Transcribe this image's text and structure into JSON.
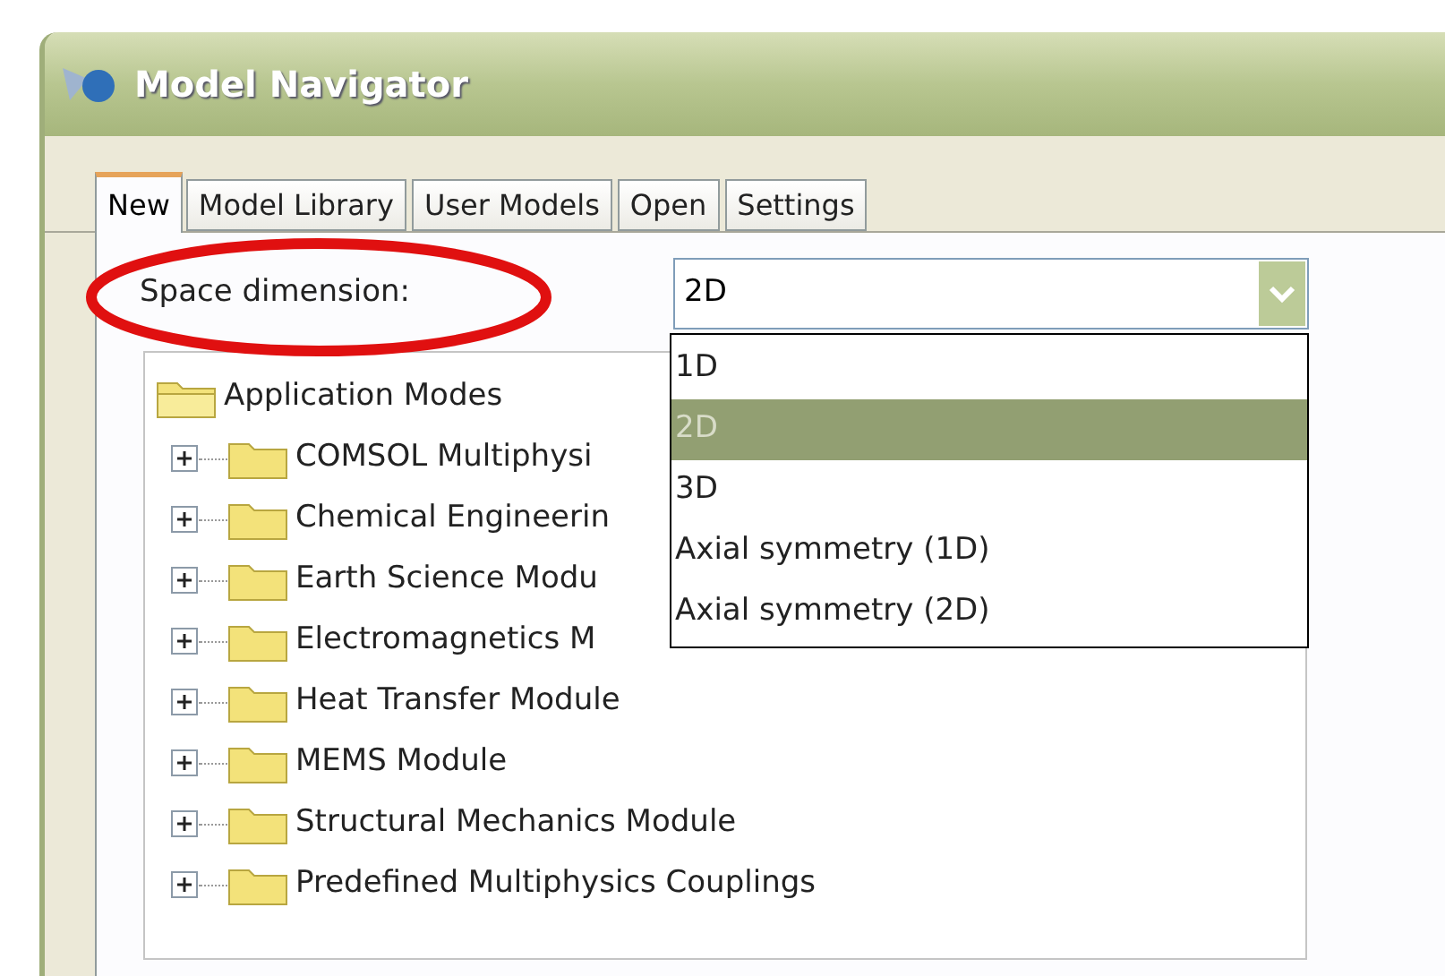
{
  "window": {
    "title": "Model Navigator"
  },
  "tabs": [
    {
      "label": "New",
      "selected": true
    },
    {
      "label": "Model Library",
      "selected": false
    },
    {
      "label": "User Models",
      "selected": false
    },
    {
      "label": "Open",
      "selected": false
    },
    {
      "label": "Settings",
      "selected": false
    }
  ],
  "space_dimension": {
    "label": "Space dimension:",
    "value": "2D",
    "expanded": true,
    "highlighted": true,
    "options": [
      {
        "label": "1D",
        "selected": false
      },
      {
        "label": "2D",
        "selected": true
      },
      {
        "label": "3D",
        "selected": false
      },
      {
        "label": "Axial symmetry (1D)",
        "selected": false
      },
      {
        "label": "Axial symmetry (2D)",
        "selected": false
      }
    ]
  },
  "tree": {
    "label": "Application Modes",
    "expanded": true,
    "children": [
      {
        "label": "COMSOL Multiphysi",
        "expanded": false
      },
      {
        "label": "Chemical Engineerin",
        "expanded": false
      },
      {
        "label": "Earth Science Modu",
        "expanded": false
      },
      {
        "label": "Electromagnetics M",
        "expanded": false
      },
      {
        "label": "Heat Transfer Module",
        "expanded": false
      },
      {
        "label": "MEMS Module",
        "expanded": false
      },
      {
        "label": "Structural Mechanics Module",
        "expanded": false
      },
      {
        "label": "Predefined Multiphysics Couplings",
        "expanded": false
      }
    ]
  }
}
